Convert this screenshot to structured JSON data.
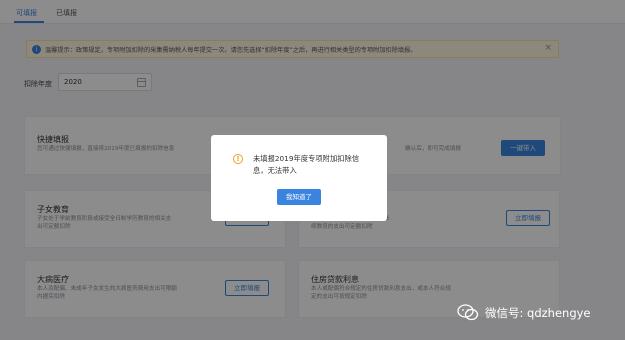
{
  "tabs": [
    {
      "label": "可填报"
    },
    {
      "label": "已填报"
    }
  ],
  "notice": {
    "icon": "info-icon",
    "text": "温馨提示：政策规定，专项附加扣除的采集需纳税人每年提交一次。请您先选择“扣除年度”之后，再进行相关类型的专项附加扣除填报。",
    "close_icon": "close-icon"
  },
  "year": {
    "label": "扣除年度",
    "value": "2020",
    "icon": "calendar-icon"
  },
  "cards": {
    "quick": {
      "title": "快捷填报",
      "desc": "您可通过快捷填报，直接将2019年度已填报的扣除信息",
      "desc2": "确认后，即可完成填报",
      "button": "一键带入"
    },
    "child": {
      "title": "子女教育",
      "desc1": "子女处于学前教育阶段或接受全日制学历教育的相关支",
      "desc2": "出可定额扣除",
      "button": "立即填报"
    },
    "continuing": {
      "desc1": "（学位）继续教育和职业资格继",
      "desc2": "续教育的支出可定额扣除",
      "button": "立即填报"
    },
    "medical": {
      "title": "大病医疗",
      "desc1": "本人及配偶、未成年子女发生的大病医药费用支出可限额",
      "desc2": "内据实扣除",
      "button": "立即填报"
    },
    "loan": {
      "title": "住房贷款利息",
      "desc1": "本人或配偶符合规定的住房贷款利息支出，或本人符合规",
      "desc2": "定的支出可按规定扣除"
    }
  },
  "modal": {
    "icon": "warning-icon",
    "line1": "未填报2019年度专项附加扣除信",
    "line2": "息，无法带入",
    "button": "我知道了"
  },
  "watermark": {
    "icon": "wechat-icon",
    "text": "微信号: qdzhengye"
  }
}
